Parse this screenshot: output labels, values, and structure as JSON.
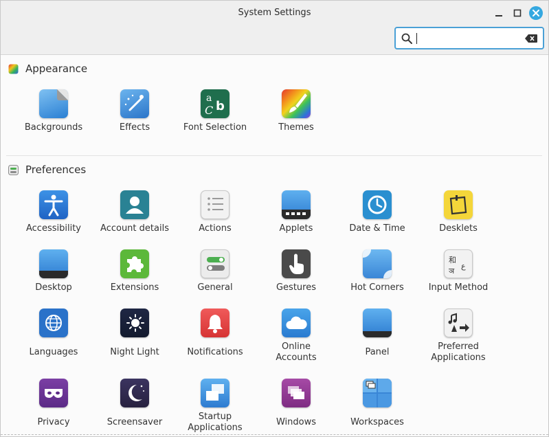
{
  "window": {
    "title": "System Settings"
  },
  "search": {
    "value": "",
    "icon": "search-icon",
    "clear_icon": "backspace-icon"
  },
  "sections": [
    {
      "label": "Appearance",
      "icon": "appearance-icon",
      "items": [
        {
          "label": "Backgrounds",
          "icon": "backgrounds-icon"
        },
        {
          "label": "Effects",
          "icon": "effects-icon"
        },
        {
          "label": "Font Selection",
          "icon": "font-selection-icon"
        },
        {
          "label": "Themes",
          "icon": "themes-icon"
        }
      ]
    },
    {
      "label": "Preferences",
      "icon": "preferences-icon",
      "items": [
        {
          "label": "Accessibility",
          "icon": "accessibility-icon"
        },
        {
          "label": "Account details",
          "icon": "account-details-icon"
        },
        {
          "label": "Actions",
          "icon": "actions-icon"
        },
        {
          "label": "Applets",
          "icon": "applets-icon"
        },
        {
          "label": "Date & Time",
          "icon": "clock-icon"
        },
        {
          "label": "Desklets",
          "icon": "desklets-icon"
        },
        {
          "label": "Desktop",
          "icon": "desktop-icon"
        },
        {
          "label": "Extensions",
          "icon": "puzzle-icon"
        },
        {
          "label": "General",
          "icon": "general-toggles-icon"
        },
        {
          "label": "Gestures",
          "icon": "hand-pointer-icon"
        },
        {
          "label": "Hot Corners",
          "icon": "hot-corners-icon"
        },
        {
          "label": "Input Method",
          "icon": "input-method-icon"
        },
        {
          "label": "Languages",
          "icon": "globe-icon"
        },
        {
          "label": "Night Light",
          "icon": "night-light-icon"
        },
        {
          "label": "Notifications",
          "icon": "bell-icon"
        },
        {
          "label": "Online",
          "label2": "Accounts",
          "icon": "cloud-icon"
        },
        {
          "label": "Panel",
          "icon": "panel-icon"
        },
        {
          "label": "Preferred",
          "label2": "Applications",
          "icon": "preferred-apps-icon"
        },
        {
          "label": "Privacy",
          "icon": "mask-icon"
        },
        {
          "label": "Screensaver",
          "icon": "moon-stars-icon"
        },
        {
          "label": "Startup",
          "label2": "Applications",
          "icon": "startup-icon"
        },
        {
          "label": "Windows",
          "icon": "windows-icon"
        },
        {
          "label": "Workspaces",
          "icon": "workspaces-icon"
        }
      ]
    }
  ]
}
